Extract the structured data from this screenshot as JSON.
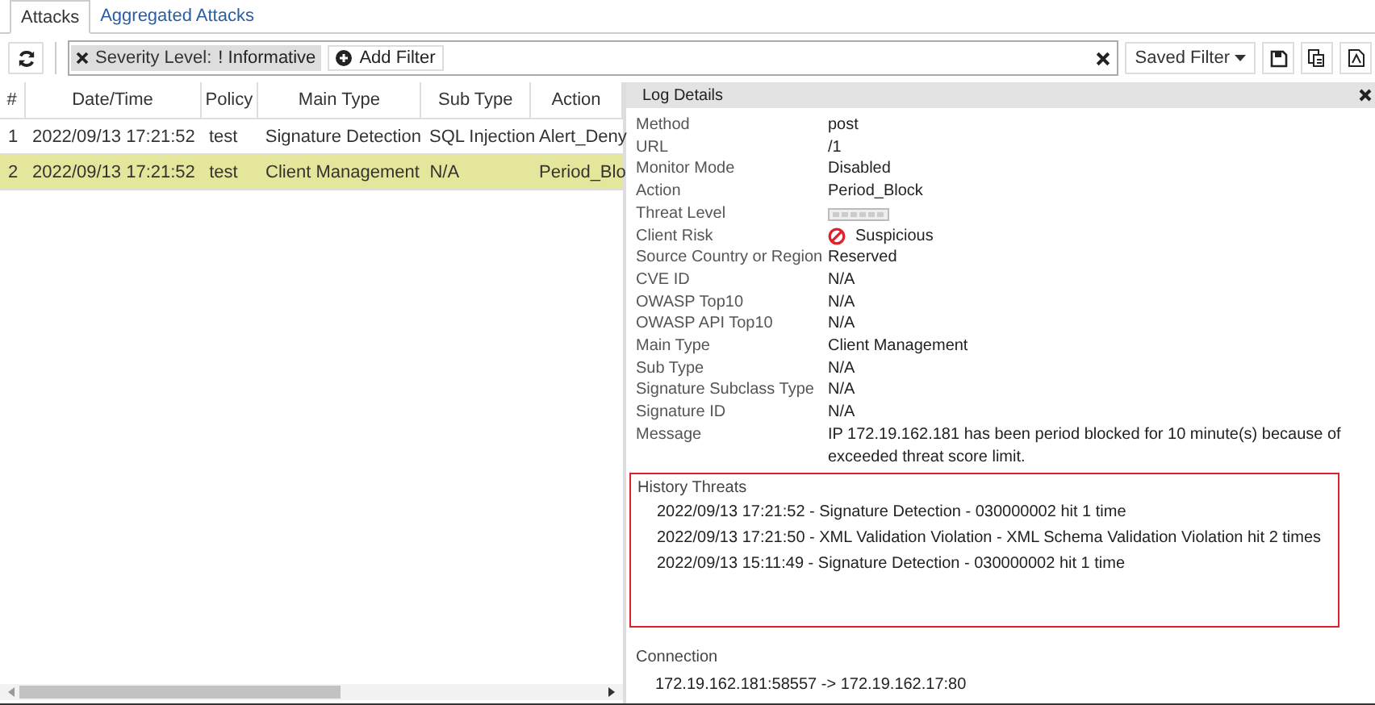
{
  "tabs": [
    {
      "label": "Attacks",
      "selected": true
    },
    {
      "label": "Aggregated Attacks",
      "selected": false
    }
  ],
  "filter_bar": {
    "chip": {
      "label": "Severity Level:",
      "value": "! Informative"
    },
    "add_filter": "Add Filter",
    "saved_filter": "Saved Filter"
  },
  "table": {
    "columns": [
      "#",
      "Date/Time",
      "Policy",
      "Main Type",
      "Sub Type",
      "Action"
    ],
    "rows": [
      {
        "cells": [
          "1",
          "2022/09/13 17:21:52",
          "test",
          "Signature Detection",
          "SQL Injection",
          "Alert_Deny"
        ],
        "selected": false
      },
      {
        "cells": [
          "2",
          "2022/09/13 17:21:52",
          "test",
          "Client Management",
          "N/A",
          "Period_Blo"
        ],
        "selected": true
      }
    ]
  },
  "log_details": {
    "title": "Log Details",
    "fields": [
      {
        "label": "Method",
        "value": "post",
        "kind": "text"
      },
      {
        "label": "URL",
        "value": "/1",
        "kind": "text"
      },
      {
        "label": "Monitor Mode",
        "value": "Disabled",
        "kind": "text"
      },
      {
        "label": "Action",
        "value": "Period_Block",
        "kind": "text"
      },
      {
        "label": "Threat Level",
        "kind": "meter"
      },
      {
        "label": "Client Risk",
        "value": "Suspicious",
        "kind": "risk"
      },
      {
        "label": "Source Country or Region",
        "value": "Reserved",
        "kind": "text"
      },
      {
        "label": "CVE ID",
        "value": "N/A",
        "kind": "text"
      },
      {
        "label": "OWASP Top10",
        "value": "N/A",
        "kind": "text"
      },
      {
        "label": "OWASP API Top10",
        "value": "N/A",
        "kind": "text"
      },
      {
        "label": "Main Type",
        "value": "Client Management",
        "kind": "text"
      },
      {
        "label": "Sub Type",
        "value": "N/A",
        "kind": "text"
      },
      {
        "label": "Signature Subclass Type",
        "value": "N/A",
        "kind": "text"
      },
      {
        "label": "Signature ID",
        "value": "N/A",
        "kind": "text"
      },
      {
        "label": "Message",
        "value": "IP 172.19.162.181 has been period blocked for 10 minute(s) because of exceeded threat score limit.",
        "kind": "text"
      }
    ],
    "history_threats": {
      "title": "History Threats",
      "items": [
        "2022/09/13 17:21:52 - Signature Detection - 030000002 hit 1 time",
        "2022/09/13 17:21:50 - XML Validation Violation - XML Schema Validation Violation hit 2 times",
        "2022/09/13 15:11:49 - Signature Detection - 030000002 hit 1 time"
      ]
    },
    "connection": {
      "title": "Connection",
      "value": "172.19.162.181:58557 -> 172.19.162.17:80"
    }
  }
}
